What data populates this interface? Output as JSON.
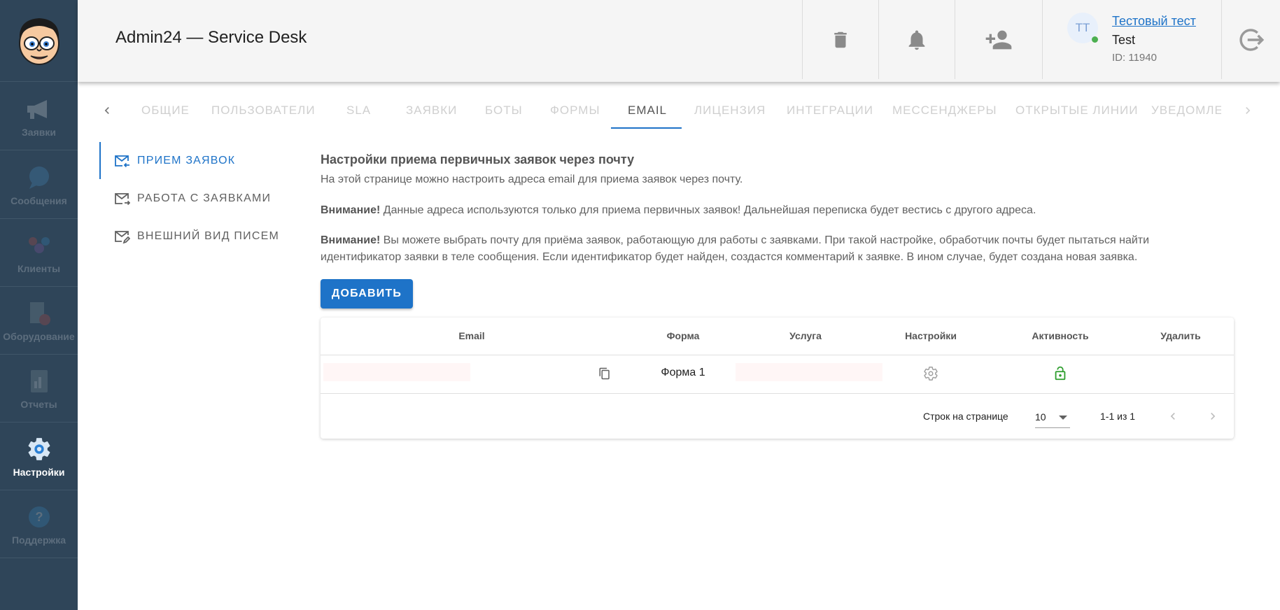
{
  "sidebar": {
    "items": [
      {
        "label": "Заявки",
        "icon": "megaphone-icon"
      },
      {
        "label": "Сообщения",
        "icon": "chat-icon"
      },
      {
        "label": "Клиенты",
        "icon": "clients-icon"
      },
      {
        "label": "Оборудование",
        "icon": "equipment-icon"
      },
      {
        "label": "Отчеты",
        "icon": "reports-icon"
      },
      {
        "label": "Настройки",
        "icon": "gear-icon"
      },
      {
        "label": "Поддержка",
        "icon": "help-icon"
      }
    ],
    "active": "Настройки"
  },
  "header": {
    "title": "Admin24 — Service Desk",
    "user": {
      "initials": "ТТ",
      "name": "Тестовый тест",
      "login": "Test",
      "id": "ID: 11940"
    }
  },
  "tabs": [
    "ОБЩИЕ",
    "ПОЛЬЗОВАТЕЛИ",
    "SLA",
    "ЗАЯВКИ",
    "БОТЫ",
    "ФОРМЫ",
    "EMAIL",
    "ЛИЦЕНЗИЯ",
    "ИНТЕГРАЦИИ",
    "МЕССЕНДЖЕРЫ",
    "ОТКРЫТЫЕ ЛИНИИ",
    "УВЕДОМЛЕ"
  ],
  "active_tab": "EMAIL",
  "subnav": [
    {
      "label": "ПРИЕМ ЗАЯВОК",
      "active": true
    },
    {
      "label": "РАБОТА С ЗАЯВКАМИ",
      "active": false
    },
    {
      "label": "ВНЕШНИЙ ВИД ПИСЕМ",
      "active": false
    }
  ],
  "content": {
    "title": "Настройки приема первичных заявок через почту",
    "intro": "На этой странице можно настроить адреса email для приема заявок через почту.",
    "warning_label": "Внимание!",
    "warning1": " Данные адреса используются только для приема первичных заявок! Дальнейшая переписка будет вестись с другого адреса.",
    "warning2": " Вы можете выбрать почту для приёма заявок, работающую для работы с заявками. При такой настройке, обработчик почты будет пытаться найти идентификатор заявки в теле сообщения. Если идентификатор будет найден, создастся комментарий к заявке. В ином случае, будет создана новая заявка.",
    "add_button": "ДОБАВИТЬ"
  },
  "table": {
    "headers": {
      "email": "Email",
      "form": "Форма",
      "service": "Услуга",
      "settings": "Настройки",
      "active": "Активность",
      "delete": "Удалить"
    },
    "rows": [
      {
        "form": "Форма 1"
      }
    ],
    "footer": {
      "rows_per_page_label": "Строк на странице",
      "rows_per_page": "10",
      "range": "1-1 из 1"
    }
  },
  "colors": {
    "sidebar": "#2f4559",
    "accent": "#1e73c8",
    "active_lock": "#2e9e2e"
  }
}
